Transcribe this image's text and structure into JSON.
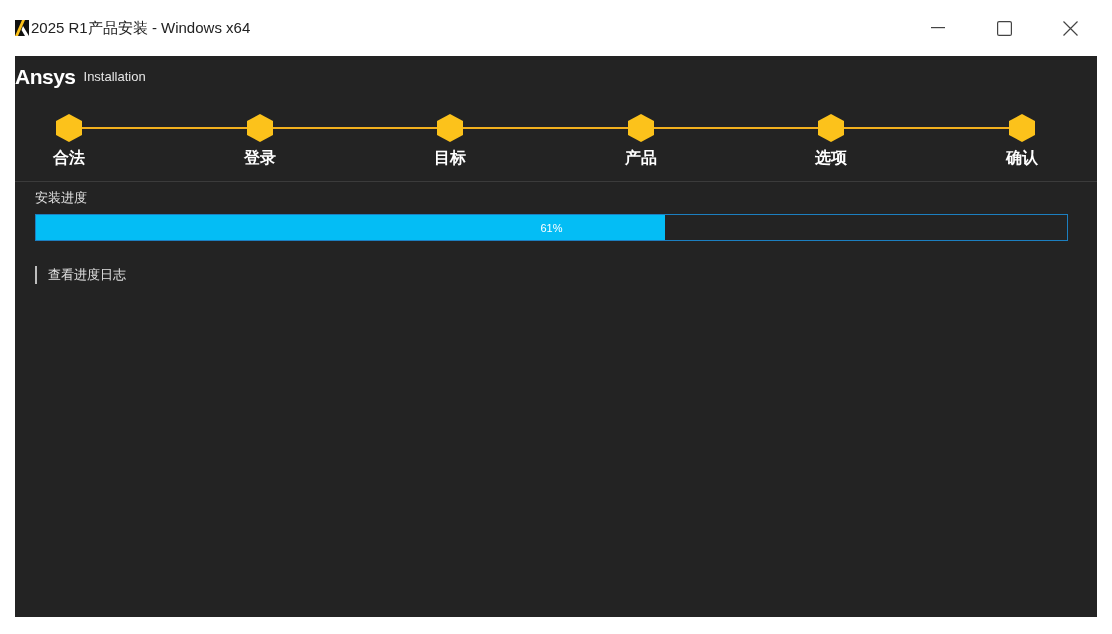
{
  "window": {
    "title": "2025 R1产品安装 - Windows x64"
  },
  "header": {
    "logo": "Ansys",
    "subtitle": "Installation"
  },
  "steps": [
    {
      "label": "合法",
      "done": true
    },
    {
      "label": "登录",
      "done": true
    },
    {
      "label": "目标",
      "done": true
    },
    {
      "label": "产品",
      "done": true
    },
    {
      "label": "选项",
      "done": true
    },
    {
      "label": "确认",
      "done": true
    }
  ],
  "progress": {
    "label": "安装进度",
    "level": 0.61,
    "reading": "61%"
  },
  "log_link": {
    "label": "查看进度日志"
  }
}
